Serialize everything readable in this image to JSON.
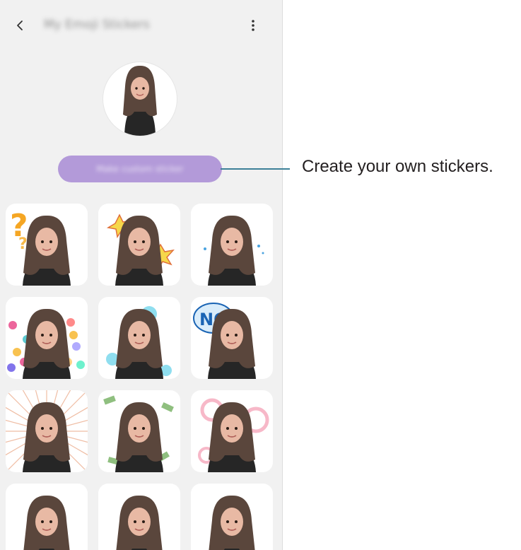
{
  "app_bar": {
    "back_icon": "chevron-left-icon",
    "title": "My Emoji Stickers",
    "more_icon": "more-vertical-icon"
  },
  "create_button": {
    "label": "Make custom sticker"
  },
  "annotation": {
    "text": "Create your own stickers."
  },
  "colors": {
    "screen_bg": "#f1f1f1",
    "button": "#b39ad9",
    "callout_line": "#3d8098",
    "hair": "#5a463c",
    "skin": "#e8b9a4",
    "shirt": "#262626"
  },
  "stickers": [
    {
      "name": "question-sticker",
      "decor": "question-marks"
    },
    {
      "name": "excited-sticker",
      "decor": "bursts"
    },
    {
      "name": "face-cover-sticker",
      "decor": "sparkles"
    },
    {
      "name": "hearts-sticker",
      "decor": "hearts"
    },
    {
      "name": "sigh-sticker",
      "decor": "blue-bubbles"
    },
    {
      "name": "no-sticker",
      "decor": "no-speech"
    },
    {
      "name": "shout-sticker",
      "decor": "rays"
    },
    {
      "name": "money-sticker",
      "decor": "money"
    },
    {
      "name": "circles-sticker",
      "decor": "pink-rings"
    },
    {
      "name": "wave-sticker",
      "decor": "none"
    },
    {
      "name": "cheer-sticker",
      "decor": "none"
    },
    {
      "name": "wink-sticker",
      "decor": "none"
    }
  ]
}
